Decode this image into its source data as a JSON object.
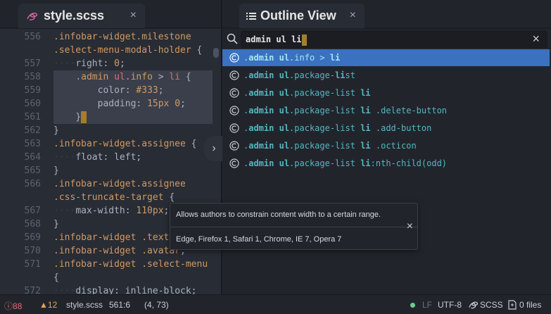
{
  "left_tab": {
    "title": "style.scss",
    "close": "×",
    "icon": "sass-icon"
  },
  "right_tab": {
    "title": "Outline View",
    "close": "×",
    "icon": "list-icon"
  },
  "editor": {
    "lines": [
      {
        "num": "556",
        "segments": [
          [
            ".infobar-widget.milestone",
            "c-sel"
          ]
        ]
      },
      {
        "num": "",
        "segments": [
          [
            ".select-menu-modal-holder",
            "c-sel"
          ],
          [
            " {",
            "c-prop"
          ]
        ]
      },
      {
        "num": "557",
        "segments": [
          [
            "····",
            "c-guide"
          ],
          [
            "right: ",
            "c-prop"
          ],
          [
            "0",
            "c-num"
          ],
          [
            ";",
            "c-prop"
          ]
        ]
      },
      {
        "num": "558",
        "segments": [
          [
            "····",
            "c-guide"
          ],
          [
            ".admin ",
            "c-sel"
          ],
          [
            "ul",
            "c-tag"
          ],
          [
            ".info",
            "c-sel"
          ],
          [
            " > ",
            "c-prop"
          ],
          [
            "li",
            "c-tag"
          ],
          [
            " {",
            "c-prop"
          ]
        ],
        "selected": true
      },
      {
        "num": "559",
        "segments": [
          [
            "········",
            "c-guide"
          ],
          [
            "color: ",
            "c-prop"
          ],
          [
            "#333",
            "c-num"
          ],
          [
            ";",
            "c-prop"
          ]
        ],
        "selected": true
      },
      {
        "num": "560",
        "segments": [
          [
            "········",
            "c-guide"
          ],
          [
            "padding: ",
            "c-prop"
          ],
          [
            "15px 0",
            "c-num"
          ],
          [
            ";",
            "c-prop"
          ]
        ],
        "selected": true
      },
      {
        "num": "561",
        "segments": [
          [
            "····",
            "c-guide"
          ],
          [
            "}",
            "c-prop"
          ]
        ],
        "selected": true,
        "cursor": true
      },
      {
        "num": "562",
        "segments": [
          [
            "}",
            "c-prop"
          ]
        ]
      },
      {
        "num": "563",
        "segments": [
          [
            ".infobar-widget.assignee",
            "c-sel"
          ],
          [
            " {",
            "c-prop"
          ]
        ]
      },
      {
        "num": "564",
        "segments": [
          [
            "····",
            "c-guide"
          ],
          [
            "float: left;",
            "c-prop"
          ]
        ]
      },
      {
        "num": "565",
        "segments": [
          [
            "}",
            "c-prop"
          ]
        ]
      },
      {
        "num": "566",
        "segments": [
          [
            ".infobar-widget.assignee",
            "c-sel"
          ]
        ]
      },
      {
        "num": "",
        "segments": [
          [
            ".css-truncate-target",
            "c-sel"
          ],
          [
            " {",
            "c-prop"
          ]
        ]
      },
      {
        "num": "567",
        "segments": [
          [
            "····",
            "c-guide"
          ],
          [
            "max-width: ",
            "c-prop"
          ],
          [
            "110px",
            "c-num"
          ],
          [
            ";",
            "c-prop"
          ]
        ]
      },
      {
        "num": "568",
        "segments": [
          [
            "}",
            "c-prop"
          ]
        ]
      },
      {
        "num": "569",
        "segments": [
          [
            ".infobar-widget .text",
            "c-sel"
          ]
        ]
      },
      {
        "num": "570",
        "segments": [
          [
            ".infobar-widget .avatar",
            "c-sel"
          ],
          [
            ",",
            "c-prop"
          ]
        ]
      },
      {
        "num": "571",
        "segments": [
          [
            ".infobar-widget .select-menu",
            "c-sel"
          ]
        ]
      },
      {
        "num": "",
        "segments": [
          [
            "{",
            "c-prop"
          ]
        ]
      },
      {
        "num": "572",
        "segments": [
          [
            "····",
            "c-guide"
          ],
          [
            "display: inline-block;",
            "c-prop"
          ]
        ]
      }
    ]
  },
  "outline": {
    "search_value": "admin ul li",
    "search_clear": "×",
    "items": [
      {
        "parts": [
          [
            ".",
            "u"
          ],
          [
            "admin",
            "m"
          ],
          [
            " ",
            "u"
          ],
          [
            "ul",
            "m"
          ],
          [
            ".info > ",
            "u"
          ],
          [
            "li",
            "m"
          ]
        ],
        "selected": true
      },
      {
        "parts": [
          [
            ".",
            "u"
          ],
          [
            "admin",
            "m"
          ],
          [
            " ",
            "u"
          ],
          [
            "ul",
            "m"
          ],
          [
            ".package-",
            "u"
          ],
          [
            "li",
            "m"
          ],
          [
            "st",
            "u"
          ]
        ]
      },
      {
        "parts": [
          [
            ".",
            "u"
          ],
          [
            "admin",
            "m"
          ],
          [
            " ",
            "u"
          ],
          [
            "ul",
            "m"
          ],
          [
            ".package-list ",
            "u"
          ],
          [
            "li",
            "m"
          ]
        ]
      },
      {
        "parts": [
          [
            ".",
            "u"
          ],
          [
            "admin",
            "m"
          ],
          [
            " ",
            "u"
          ],
          [
            "ul",
            "m"
          ],
          [
            ".package-list ",
            "u"
          ],
          [
            "li",
            "m"
          ],
          [
            " .delete-button",
            "u"
          ]
        ]
      },
      {
        "parts": [
          [
            ".",
            "u"
          ],
          [
            "admin",
            "m"
          ],
          [
            " ",
            "u"
          ],
          [
            "ul",
            "m"
          ],
          [
            ".package-list ",
            "u"
          ],
          [
            "li",
            "m"
          ],
          [
            " .add-button",
            "u"
          ]
        ]
      },
      {
        "parts": [
          [
            ".",
            "u"
          ],
          [
            "admin",
            "m"
          ],
          [
            " ",
            "u"
          ],
          [
            "ul",
            "m"
          ],
          [
            ".package-list ",
            "u"
          ],
          [
            "li",
            "m"
          ],
          [
            " .octicon",
            "u"
          ]
        ]
      },
      {
        "parts": [
          [
            ".",
            "u"
          ],
          [
            "admin",
            "m"
          ],
          [
            " ",
            "u"
          ],
          [
            "ul",
            "m"
          ],
          [
            ".package-list ",
            "u"
          ],
          [
            "li",
            "m"
          ],
          [
            ":nth-child(odd)",
            "u"
          ]
        ]
      }
    ]
  },
  "tooltip": {
    "description": "Allows authors to constrain content width to a certain range.",
    "compat": "Edge, Firefox 1, Safari 1, Chrome, IE 7, Opera 7",
    "close": "×"
  },
  "status": {
    "errors": "88",
    "warnings": "12",
    "file": "style.scss",
    "position": "561:6",
    "cols": "(4, 73)",
    "line_ending": "LF",
    "encoding": "UTF-8",
    "grammar": "SCSS",
    "files": "0 files"
  },
  "colors": {
    "accent": "#3a71c1",
    "selector": "#d19a66",
    "tag": "#e06c75",
    "match": "#56b6c2",
    "error": "#e06c75",
    "warning": "#e5a455",
    "ok": "#73c990"
  }
}
